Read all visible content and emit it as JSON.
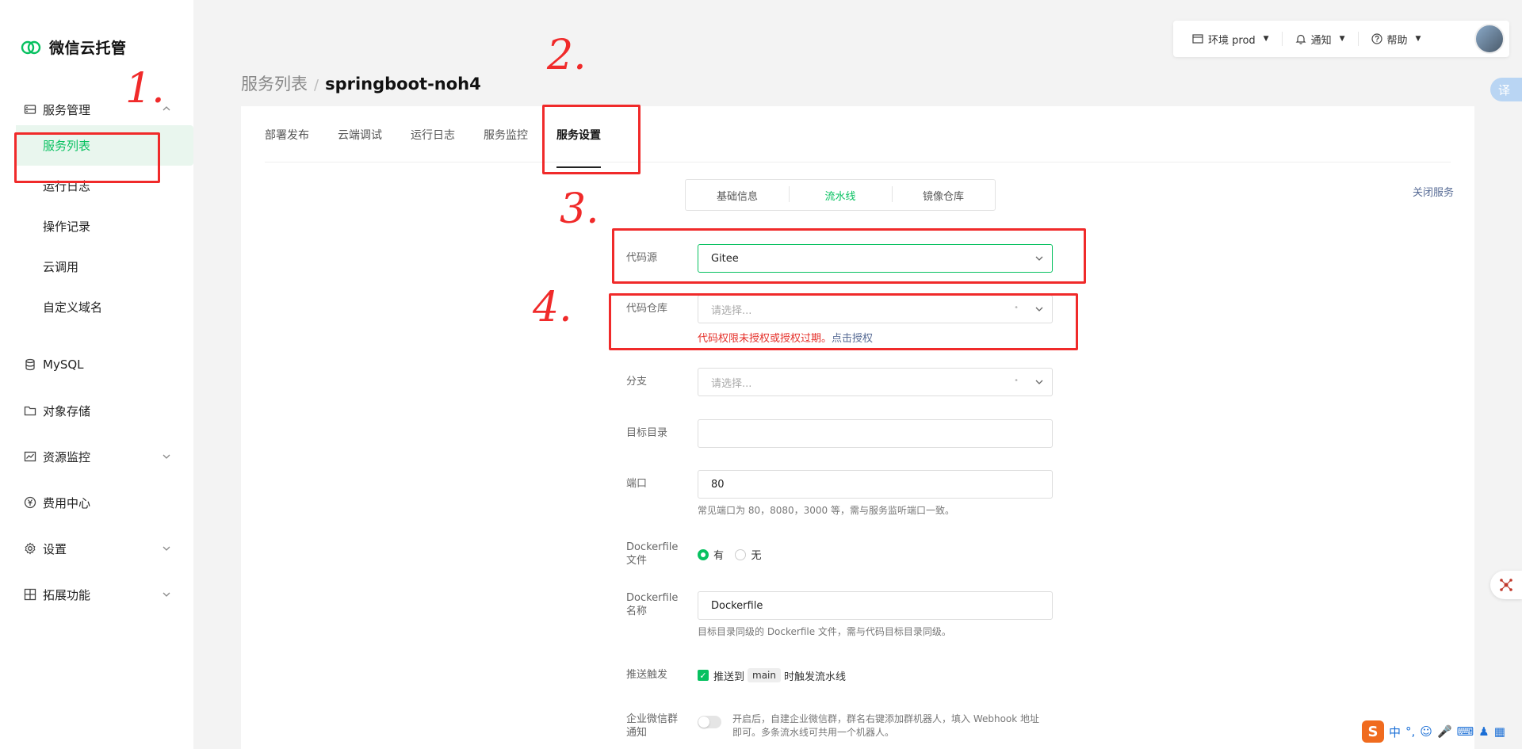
{
  "app": {
    "name": "微信云托管"
  },
  "sidebar": {
    "groups": [
      {
        "label": "服务管理",
        "icon": "server-icon",
        "expanded": true,
        "items": [
          {
            "label": "服务列表",
            "active": true
          },
          {
            "label": "运行日志"
          },
          {
            "label": "操作记录"
          },
          {
            "label": "云调用"
          },
          {
            "label": "自定义域名"
          }
        ]
      },
      {
        "label": "MySQL",
        "icon": "database-icon"
      },
      {
        "label": "对象存储",
        "icon": "folder-icon"
      },
      {
        "label": "资源监控",
        "icon": "chart-icon",
        "expandable": true
      },
      {
        "label": "费用中心",
        "icon": "yen-icon"
      },
      {
        "label": "设置",
        "icon": "gear-icon",
        "expandable": true
      },
      {
        "label": "拓展功能",
        "icon": "grid-icon",
        "expandable": true
      }
    ]
  },
  "topbar": {
    "env": "环境 prod",
    "notify": "通知",
    "help": "帮助"
  },
  "floating": {
    "translate": "译"
  },
  "breadcrumb": {
    "parent": "服务列表",
    "separator": "/",
    "current": "springboot-noh4"
  },
  "tabs": [
    "部署发布",
    "云端调试",
    "运行日志",
    "服务监控",
    "服务设置"
  ],
  "active_tab": "服务设置",
  "subtabs": [
    "基础信息",
    "流水线",
    "镜像仓库"
  ],
  "active_subtab": "流水线",
  "close_service": "关闭服务",
  "form": {
    "code_source": {
      "label": "代码源",
      "value": "Gitee"
    },
    "repo": {
      "label": "代码仓库",
      "placeholder": "请选择...",
      "error": "代码权限未授权或授权过期。",
      "error_link": "点击授权"
    },
    "branch": {
      "label": "分支",
      "placeholder": "请选择..."
    },
    "target_dir": {
      "label": "目标目录",
      "value": ""
    },
    "port": {
      "label": "端口",
      "value": "80",
      "hint": "常见端口为 80，8080，3000 等，需与服务监听端口一致。"
    },
    "dockerfile": {
      "label_line1": "Dockerfile",
      "label_line2": "文件",
      "opt_yes": "有",
      "opt_no": "无",
      "selected": "有"
    },
    "dockerfile_name": {
      "label_line1": "Dockerfile",
      "label_line2": "名称",
      "value": "Dockerfile",
      "hint": "目标目录同级的 Dockerfile 文件，需与代码目标目录同级。"
    },
    "push_trigger": {
      "label": "推送触发",
      "checked": true,
      "text_before": "推送到",
      "branch": "main",
      "text_after": "时触发流水线"
    },
    "wecom": {
      "label_line1": "企业微信群",
      "label_line2": "通知",
      "enabled": false,
      "desc_line1": "开启后，自建企业微信群，群名右键添加群机器人，填入 Webhook 地址",
      "desc_line2": "即可。多条流水线可共用一个机器人。"
    }
  },
  "annotations": [
    "1.",
    "2.",
    "3.",
    "4."
  ],
  "ime": {
    "logo": "S",
    "lang": "中",
    "punct": "°,"
  },
  "colors": {
    "accent": "#07c160",
    "annotation": "#f02a2a",
    "link": "#576b95",
    "error": "#e5312b"
  }
}
